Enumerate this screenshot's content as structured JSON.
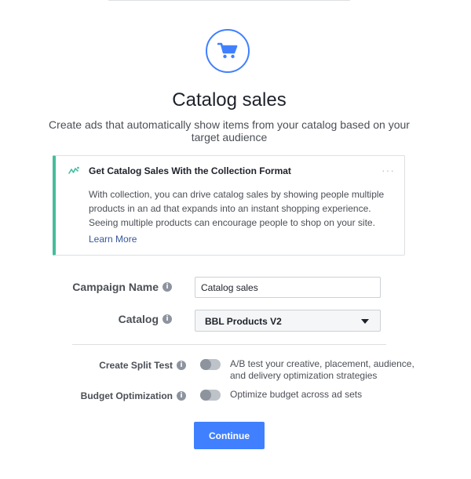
{
  "hero": {
    "icon": "shopping-cart-icon",
    "title": "Catalog sales",
    "description": "Create ads that automatically show items from your catalog based on your target audience"
  },
  "info_card": {
    "icon": "collection-format-icon",
    "title": "Get Catalog Sales With the Collection Format",
    "more_icon": "···",
    "body": "With collection, you can drive catalog sales by showing people multiple products in an ad that expands into an instant shopping experience. Seeing multiple products can encourage people to shop on your site.",
    "link": "Learn More",
    "accent_color": "#45bd9d"
  },
  "form": {
    "campaign_name_label": "Campaign Name",
    "campaign_name_value": "Catalog sales",
    "catalog_label": "Catalog",
    "catalog_value": "BBL Products V2",
    "info_glyph": "i"
  },
  "options": {
    "split_test_label": "Create Split Test",
    "split_test_desc": "A/B test your creative, placement, audience, and delivery optimization strategies",
    "split_test_on": false,
    "budget_label": "Budget Optimization",
    "budget_desc": "Optimize budget across ad sets",
    "budget_on": false
  },
  "actions": {
    "continue_label": "Continue",
    "primary_color": "#4080ff"
  }
}
